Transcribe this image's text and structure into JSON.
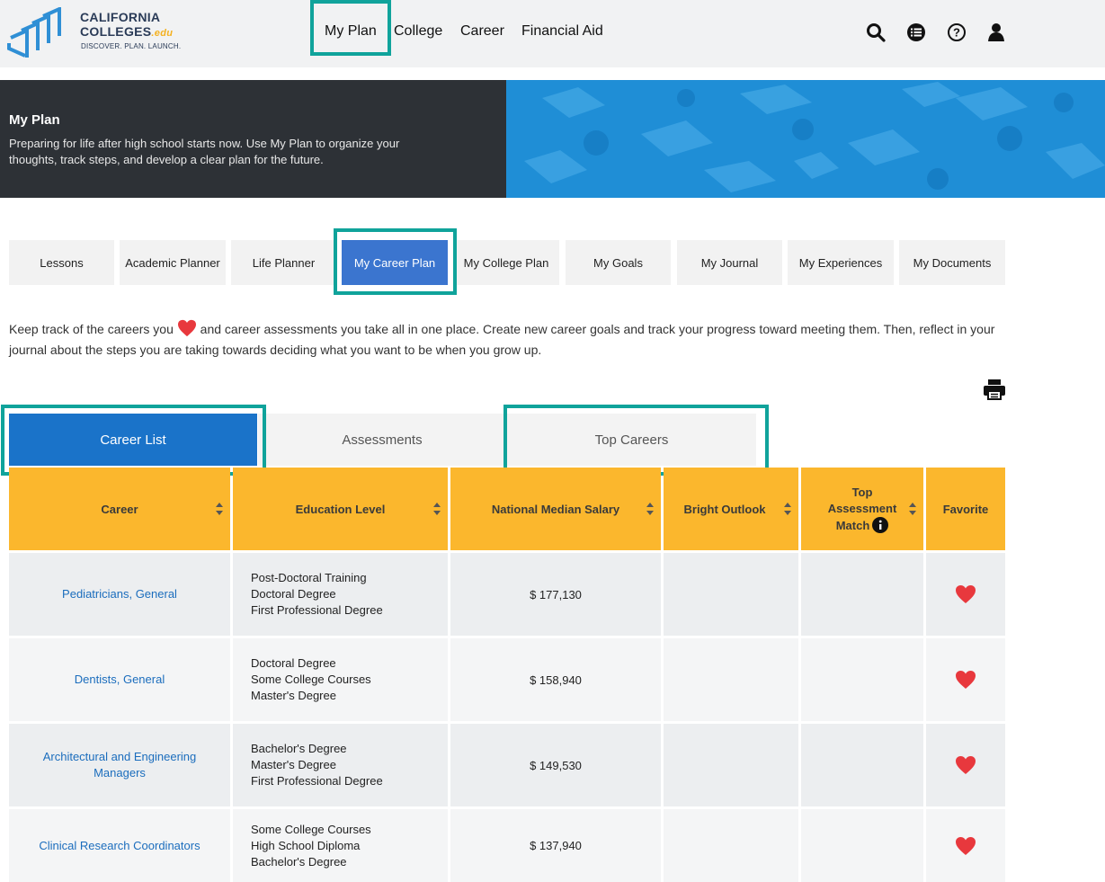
{
  "header": {
    "logo_line1": "CALIFORNIA",
    "logo_line2": "COLLEGES",
    "logo_edu": ".edu",
    "logo_tagline": "DISCOVER. PLAN. LAUNCH.",
    "nav": [
      "My Plan",
      "College",
      "Career",
      "Financial Aid"
    ],
    "icons": [
      "search-icon",
      "menu-list-icon",
      "help-icon",
      "user-icon"
    ]
  },
  "banner": {
    "title": "My Plan",
    "description": "Preparing for life after high school starts now. Use My Plan to organize your thoughts, track steps, and develop a clear plan for the future."
  },
  "subtabs": [
    "Lessons",
    "Academic Planner",
    "Life Planner",
    "My Career Plan",
    "My College Plan",
    "My Goals",
    "My Journal",
    "My Experiences",
    "My Documents"
  ],
  "intro": {
    "part1": "Keep track of the careers you",
    "part2": "and career assessments you take all in one place. Create new career goals and track your progress toward meeting them. Then, reflect in your journal about the steps you are taking towards deciding what you want to be when you grow up."
  },
  "content_tabs": [
    "Career List",
    "Assessments",
    "Top Careers"
  ],
  "table": {
    "headers": {
      "career": "Career",
      "education": "Education Level",
      "salary": "National Median Salary",
      "outlook": "Bright Outlook",
      "top1": "Top",
      "top2": "Assessment",
      "top3": "Match",
      "favorite": "Favorite"
    },
    "rows": [
      {
        "career": "Pediatricians, General",
        "education": [
          "Post-Doctoral Training",
          "Doctoral Degree",
          "First Professional Degree"
        ],
        "salary": "$ 177,130"
      },
      {
        "career": "Dentists, General",
        "education": [
          "Doctoral Degree",
          "Some College Courses",
          "Master's Degree"
        ],
        "salary": "$ 158,940"
      },
      {
        "career": "Architectural and Engineering Managers",
        "education": [
          "Bachelor's Degree",
          "Master's Degree",
          "First Professional Degree"
        ],
        "salary": "$ 149,530"
      },
      {
        "career": "Clinical Research Coordinators",
        "education": [
          "Some College Courses",
          "High School Diploma",
          "Bachelor's Degree"
        ],
        "salary": "$ 137,940"
      }
    ]
  },
  "colors": {
    "accent_teal": "#10a39b",
    "table_header": "#fbb72d",
    "active_tab": "#1a73c9",
    "subtab_active": "#3b75cf",
    "heart": "#e8383d",
    "link": "#1b6dbd"
  }
}
